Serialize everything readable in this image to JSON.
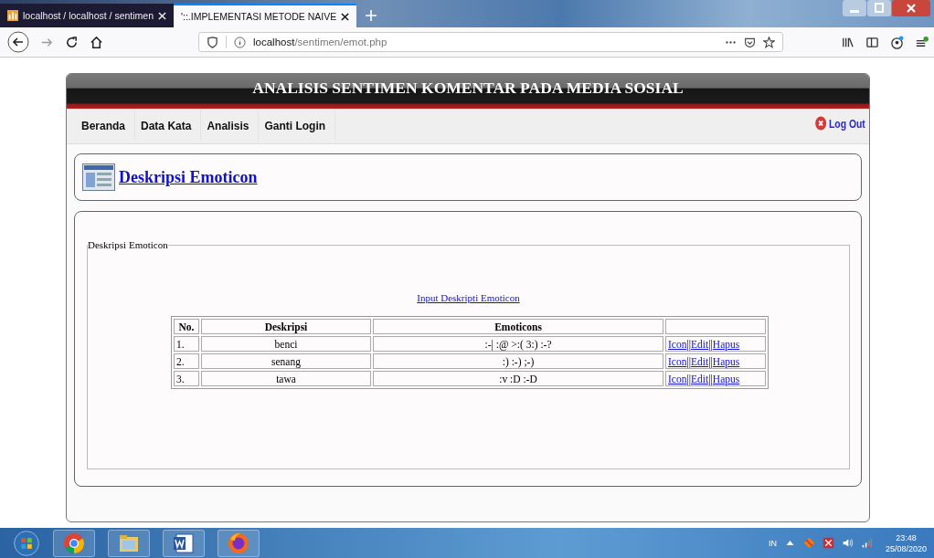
{
  "browser": {
    "tabs": [
      {
        "title": "localhost / localhost / sentimen",
        "selected": false
      },
      {
        "title": "'::.IMPLEMENTASI METODE NAIVE",
        "selected": true
      }
    ],
    "url": {
      "host": "localhost",
      "path": "/sentimen/emot.php"
    }
  },
  "page": {
    "title": "ANALISIS SENTIMEN KOMENTAR PADA MEDIA SOSIAL",
    "nav": [
      {
        "label": "Beranda"
      },
      {
        "label": "Data Kata"
      },
      {
        "label": "Analisis"
      },
      {
        "label": "Ganti Login"
      }
    ],
    "logout": "Log Out",
    "section_title": "Deskripsi Emoticon",
    "legend": "Deskripsi Emoticon",
    "input_link": "Input Deskripti Emoticon",
    "table": {
      "columns": [
        "No.",
        "Deskripsi",
        "Emoticons",
        ""
      ],
      "rows": [
        {
          "no": "1.",
          "deskripsi": "benci",
          "emoticons": ":-| :@ >:( 3:) :-?",
          "actions": [
            "Icon",
            "Edit",
            "Hapus"
          ],
          "separator": "||"
        },
        {
          "no": "2.",
          "deskripsi": "senang",
          "emoticons": ":) :-) ;-)",
          "actions": [
            "Icon",
            "Edit",
            "Hapus"
          ],
          "separator": "||"
        },
        {
          "no": "3.",
          "deskripsi": "tawa",
          "emoticons": ":v :D :-D",
          "actions": [
            "Icon",
            "Edit",
            "Hapus"
          ],
          "separator": "||"
        }
      ]
    }
  },
  "taskbar": {
    "language": "IN",
    "time": "23:48",
    "date": "25/08/2020"
  }
}
